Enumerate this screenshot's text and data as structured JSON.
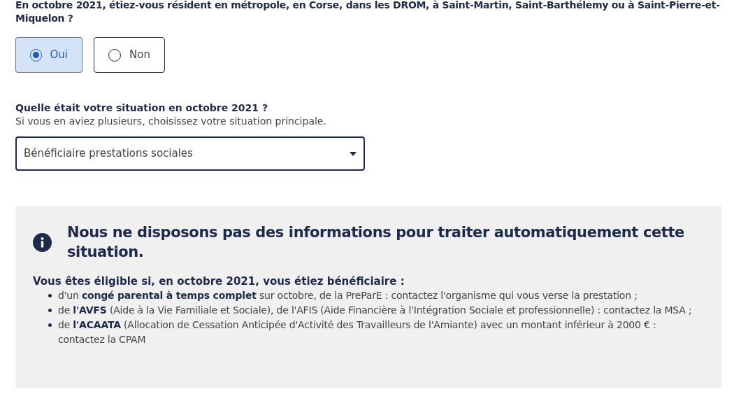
{
  "question": "En octobre 2021, étiez-vous résident en métropole, en Corse, dans les DROM, à Saint-Martin, Saint-Barthélemy ou à Saint-Pierre-et-Miquelon ?",
  "options": [
    {
      "label": "Oui",
      "selected": true
    },
    {
      "label": "Non",
      "selected": false
    }
  ],
  "situation": {
    "label": "Quelle était votre situation en octobre 2021 ?",
    "hint": "Si vous en aviez plusieurs, choisissez votre situation principale.",
    "value": "Bénéficiaire prestations sociales"
  },
  "notice": {
    "title": "Nous ne disposons pas des informations pour traiter automatiquement cette situation.",
    "intro": "Vous êtes éligible si, en octobre 2021, vous étiez bénéficiaire :",
    "items": [
      "d'un **congé parental à temps complet** sur octobre, de la PreParE : contactez l'organisme qui vous verse la prestation ;",
      "de **l'AVFS** (Aide à la Vie Familiale et Sociale), de l'AFIS (Aide Financière à l'Intégration Sociale et professionnelle) : contactez la MSA ;",
      "de **l'ACAATA** (Allocation de Cessation Anticipée d'Activité des Travailleurs de l'Amiante) avec un montant inférieur à 2000 € : contactez la CPAM"
    ]
  }
}
